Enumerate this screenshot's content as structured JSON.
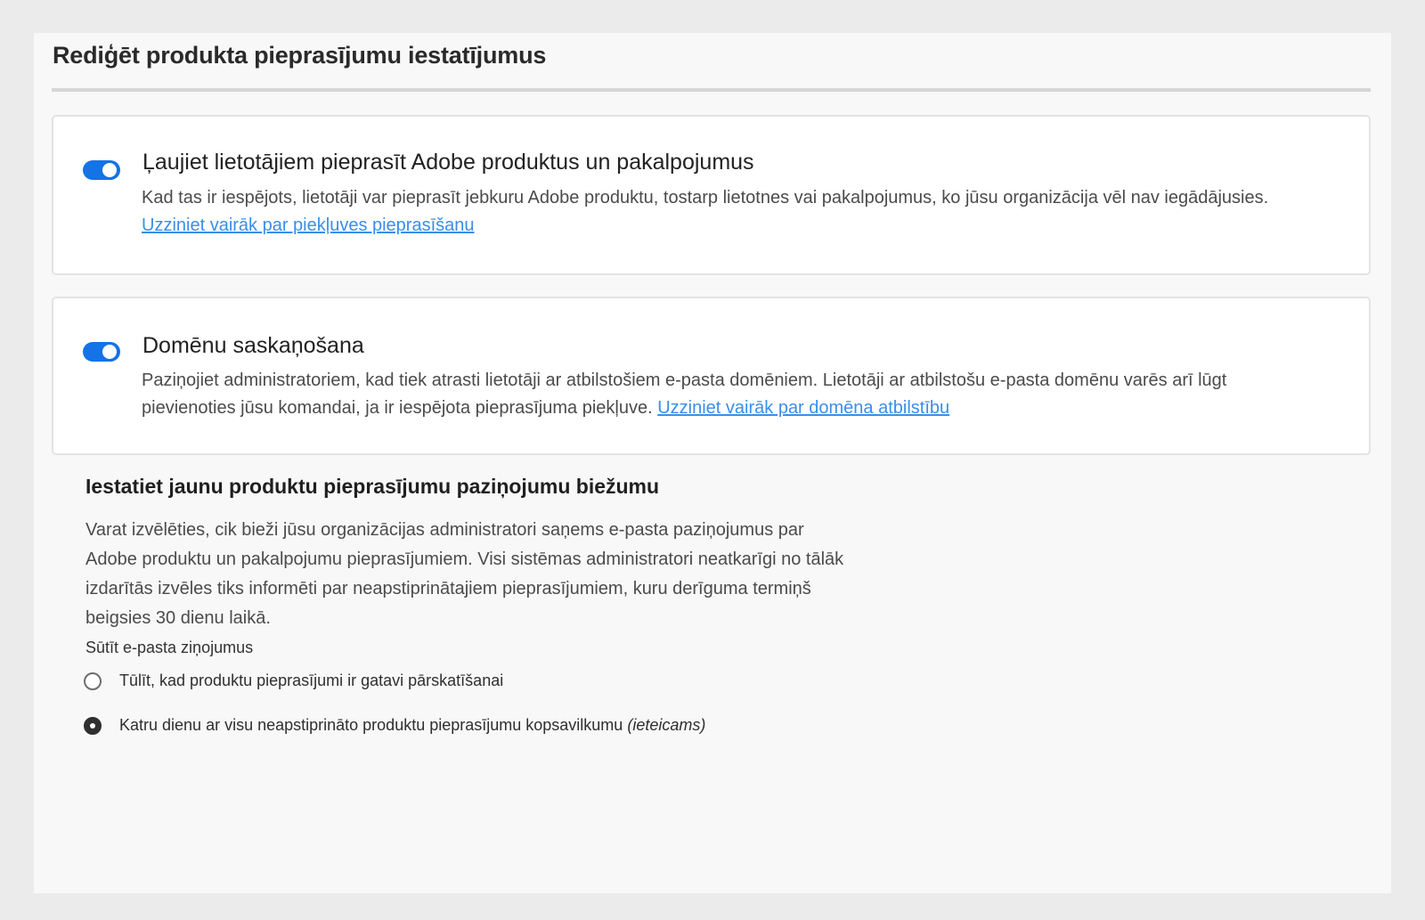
{
  "page": {
    "title": "Rediģēt produkta pieprasījumu iestatījumus"
  },
  "access_request": {
    "toggle_state": "on",
    "title": "Ļaujiet lietotājiem pieprasīt Adobe produktus un pakalpojumus",
    "description": "Kad tas ir iespējots, lietotāji var pieprasīt jebkuru Adobe produktu, tostarp lietotnes vai pakalpojumus, ko jūsu organizācija vēl nav iegādājusies.",
    "link": "Uzziniet vairāk par piekļuves pieprasīšanu"
  },
  "domain_matching": {
    "toggle_state": "on",
    "title": "Domēnu saskaņošana",
    "description": "Paziņojiet administratoriem, kad tiek atrasti lietotāji ar atbilstošiem e-pasta domēniem. Lietotāji ar atbilstošu e-pasta domēnu varēs arī lūgt pievienoties jūsu komandai, ja ir iespējota pieprasījuma piekļuve.",
    "link": "Uzziniet vairāk par domēna atbilstību"
  },
  "notification_frequency": {
    "title": "Iestatiet jaunu produktu pieprasījumu paziņojumu biežumu",
    "description": "Varat izvēlēties, cik bieži jūsu organizācijas administratori saņems e-pasta paziņojumus par Adobe produktu un pakalpojumu pieprasījumiem. Visi sistēmas administratori neatkarīgi no tālāk izdarītās izvēles tiks informēti par neapstiprinātajiem pieprasījumiem, kuru derīguma termiņš beigsies 30 dienu laikā.",
    "send_label": "Sūtīt e-pasta ziņojumus",
    "options": [
      {
        "label": "Tūlīt, kad produktu pieprasījumi ir gatavi pārskatīšanai",
        "suffix": "",
        "selected": false
      },
      {
        "label": "Katru dienu ar visu neapstiprināto produktu pieprasījumu kopsavilkumu",
        "suffix": "(ieteicams)",
        "selected": true
      }
    ]
  },
  "colors": {
    "toggle_on": "#1473e6",
    "link": "#3a8eea",
    "background": "#ebebeb",
    "panel": "#f8f8f8"
  }
}
